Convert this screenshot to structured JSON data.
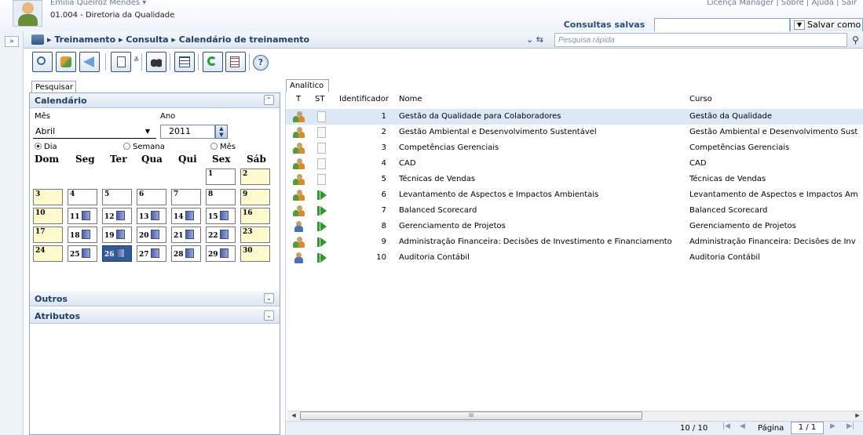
{
  "header": {
    "user_name": "Emilia Queiroz Mendes ▾",
    "org": "01.004 - Diretoria da Qualidade",
    "top_links": "Licença Manager | Sobre | Ajuda | Sair",
    "saved_queries_label": "Consultas salvas",
    "save_as_label": "Salvar como"
  },
  "breadcrumb": {
    "text": "▸ Treinamento ▸ Consulta ▸ Calendário de treinamento",
    "nav": "⌄ ⇆",
    "quick_search_placeholder": "Pesquisa rápida"
  },
  "toolbar": {
    "icons": [
      "search-icon",
      "broom-icon",
      "back-icon",
      "document-icon",
      "binoculars-icon",
      "grid-icon",
      "refresh-icon",
      "list-icon",
      "help-icon"
    ]
  },
  "left": {
    "tab_label": "Pesquisar",
    "calendar": {
      "title": "Calendário",
      "month_label": "Mês",
      "year_label": "Ano",
      "month_value": "Abril",
      "year_value": "2011",
      "radio_day": "Dia",
      "radio_week": "Semana",
      "radio_month": "Mês",
      "days": [
        "Dom",
        "Seg",
        "Ter",
        "Qua",
        "Qui",
        "Sex",
        "Sáb"
      ],
      "cells": [
        "1",
        "2",
        "3",
        "4",
        "5",
        "6",
        "7",
        "8",
        "9",
        "10",
        "11",
        "12",
        "13",
        "14",
        "15",
        "16",
        "17",
        "18",
        "19",
        "20",
        "21",
        "22",
        "23",
        "24",
        "25",
        "26",
        "27",
        "28",
        "29",
        "30"
      ],
      "selected_day": "26"
    },
    "others_title": "Outros",
    "attributes_title": "Atributos"
  },
  "grid": {
    "tab_label": "Analítico",
    "columns": [
      "T",
      "ST",
      "Identificador",
      "Nome",
      "Curso"
    ],
    "rows": [
      {
        "id": "1",
        "name": "Gestão da Qualidade para Colaboradores",
        "course": "Gestão da Qualidade"
      },
      {
        "id": "2",
        "name": "Gestão Ambiental e Desenvolvimento Sustentável",
        "course": "Gestão Ambiental e Desenvolvimento Sust"
      },
      {
        "id": "3",
        "name": "Competências Gerenciais",
        "course": "Competências Gerenciais"
      },
      {
        "id": "4",
        "name": "CAD",
        "course": "CAD"
      },
      {
        "id": "5",
        "name": "Técnicas de Vendas",
        "course": "Técnicas de Vendas"
      },
      {
        "id": "6",
        "name": "Levantamento de Aspectos e Impactos Ambientais",
        "course": "Levantamento de Aspectos e Impactos Am"
      },
      {
        "id": "7",
        "name": "Balanced Scorecard",
        "course": "Balanced Scorecard"
      },
      {
        "id": "8",
        "name": "Gerenciamento de Projetos",
        "course": "Gerenciamento de Projetos"
      },
      {
        "id": "9",
        "name": "Administração Financeira: Decisões de Investimento e Financiamento",
        "course": "Administração Financeira: Decisões de Inv"
      },
      {
        "id": "10",
        "name": "Auditoria Contábil",
        "course": "Auditoria Contábil"
      }
    ],
    "count": "10 / 10",
    "page_label": "Página",
    "page_value": "1 / 1",
    "scroll_grip": "III"
  }
}
